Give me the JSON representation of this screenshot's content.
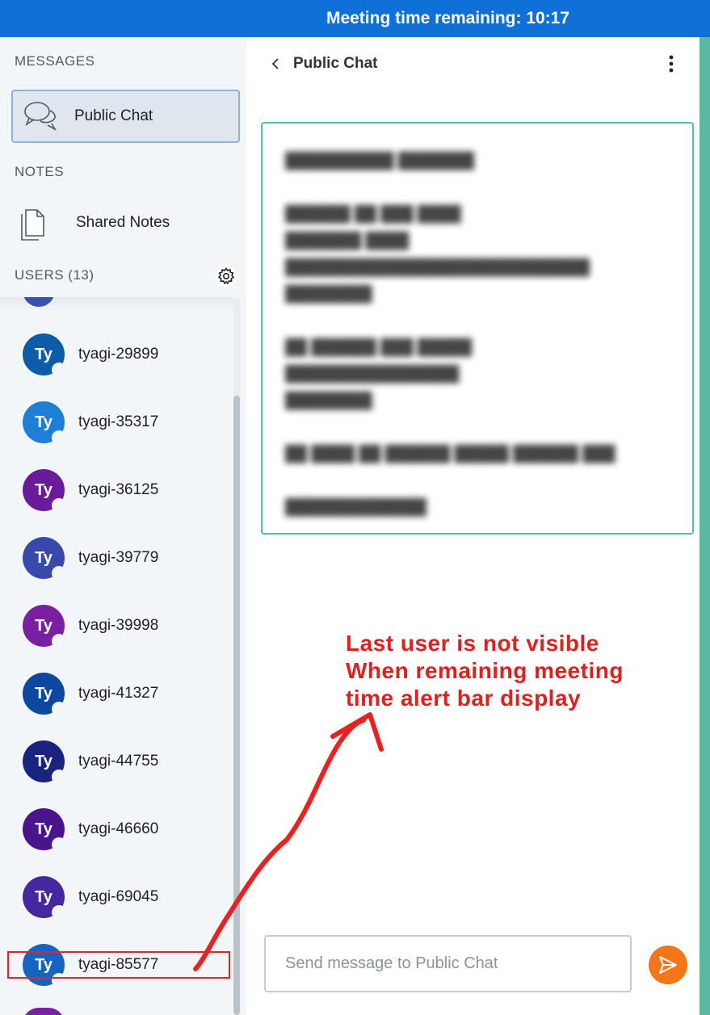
{
  "alert": {
    "text": "Meeting time remaining: 10:17"
  },
  "sidebar": {
    "messages_title": "MESSAGES",
    "public_chat_label": "Public Chat",
    "notes_title": "NOTES",
    "shared_notes_label": "Shared Notes",
    "users_title": "USERS (13)"
  },
  "users": [
    {
      "initials": "Ty",
      "name": "tyagi-29899",
      "color": "#0d5ca8"
    },
    {
      "initials": "Ty",
      "name": "tyagi-35317",
      "color": "#1e7fd8"
    },
    {
      "initials": "Ty",
      "name": "tyagi-36125",
      "color": "#6a1b9a"
    },
    {
      "initials": "Ty",
      "name": "tyagi-39779",
      "color": "#3949ab"
    },
    {
      "initials": "Ty",
      "name": "tyagi-39998",
      "color": "#7b1fa2"
    },
    {
      "initials": "Ty",
      "name": "tyagi-41327",
      "color": "#0d47a1"
    },
    {
      "initials": "Ty",
      "name": "tyagi-44755",
      "color": "#1a237e"
    },
    {
      "initials": "Ty",
      "name": "tyagi-46660",
      "color": "#4a148c"
    },
    {
      "initials": "Ty",
      "name": "tyagi-69045",
      "color": "#4527a0"
    },
    {
      "initials": "Ty",
      "name": "tyagi-85577",
      "color": "#1565c0"
    }
  ],
  "chat": {
    "title": "Public Chat",
    "input_placeholder": "Send message to Public Chat"
  },
  "annotation": {
    "lines": [
      "Last user is not visible",
      "When remaining meeting",
      "time alert bar display"
    ]
  },
  "colors": {
    "alert_bar": "#0f70d7",
    "welcome_border": "#4fc2a5",
    "send_button": "#f4761b",
    "annotation": "#e0201e"
  }
}
